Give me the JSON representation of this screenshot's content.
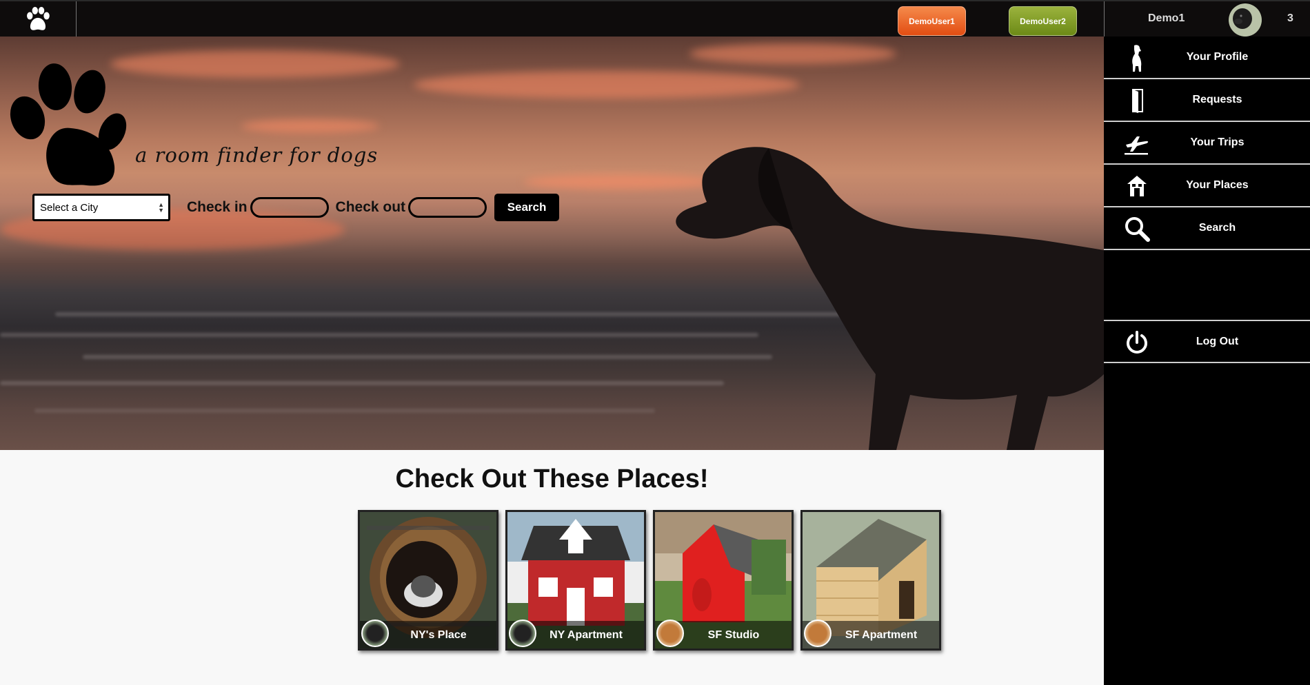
{
  "topbar": {
    "logo_icon": "paw-icon",
    "demo_user_1": "DemoUser1",
    "demo_user_2": "DemoUser2",
    "user_name": "Demo1",
    "user_avatar": "dog-avatar",
    "notification_count": "3"
  },
  "hero": {
    "logo_icon": "paw-icon",
    "tagline": "a room finder for dogs",
    "city_select": "Select a City",
    "check_in_label": "Check in",
    "check_out_label": "Check out",
    "search_button": "Search"
  },
  "places": {
    "title": "Check Out These Places!",
    "items": [
      {
        "label": "NY's Place"
      },
      {
        "label": "NY Apartment"
      },
      {
        "label": "SF Studio"
      },
      {
        "label": "SF Apartment"
      }
    ]
  },
  "sidenav": {
    "items": [
      {
        "label": "Your Profile",
        "icon": "dog-icon"
      },
      {
        "label": "Requests",
        "icon": "door-icon"
      },
      {
        "label": "Your Trips",
        "icon": "airplane-icon"
      },
      {
        "label": "Your Places",
        "icon": "house-icon"
      },
      {
        "label": "Search",
        "icon": "search-icon"
      },
      {
        "label": "Log Out",
        "icon": "power-icon"
      }
    ]
  },
  "colors": {
    "demo_user_1": "#e85a1c",
    "demo_user_2": "#7f9c22",
    "nav_bg": "#000000"
  }
}
